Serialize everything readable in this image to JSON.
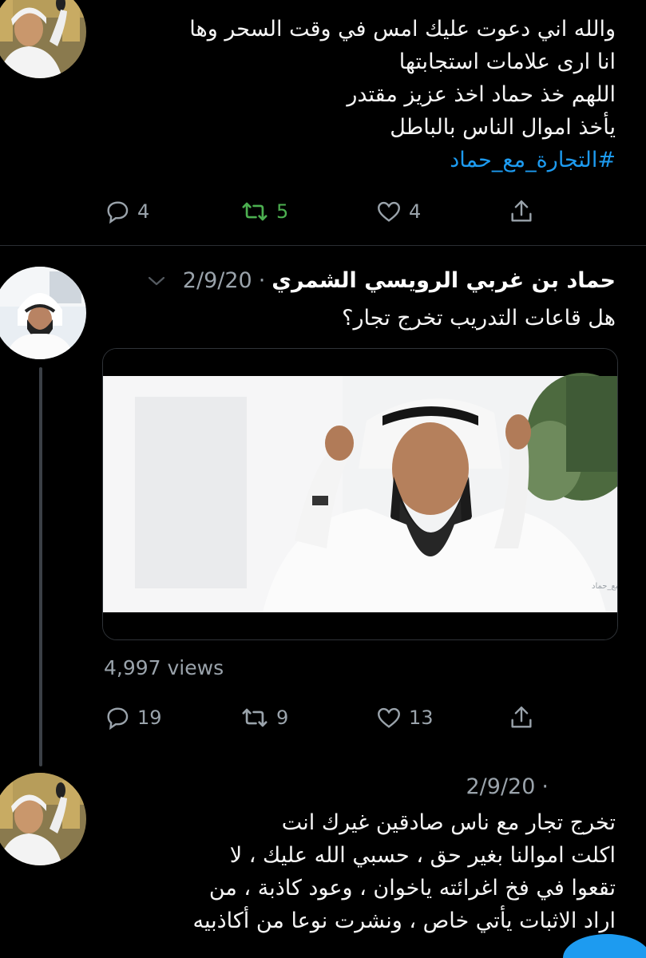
{
  "tweet1": {
    "text_lines": [
      "والله اني دعوت عليك امس في وقت السحر وها",
      "انا ارى علامات استجابتها",
      "اللهم خذ حماد اخذ عزيز مقتدر",
      "يأخذ اموال الناس بالباطل"
    ],
    "hashtag": "#التجارة_مع_حماد",
    "replies": "4",
    "retweets": "5",
    "likes": "4"
  },
  "tweet2": {
    "display_name": "حماد بن غربي الرويسي الشمري",
    "separator": "·",
    "date": "2/9/20",
    "text": "هل قاعات التدريب تخرج تجار؟",
    "video_watermark": "#التجارة_مع_حماد",
    "views": "4,997 views",
    "replies": "19",
    "retweets": "9",
    "likes": "13"
  },
  "tweet3": {
    "separator": "·",
    "date": "2/9/20",
    "text_lines": [
      "تخرج تجار مع ناس صادقين غيرك انت",
      "اكلت اموالنا بغير حق ، حسبي الله عليك ، لا",
      "تقعوا في فخ اغرائته ياخوان ، وعود كاذبة ، من",
      "اراد الاثبات يأتي خاص ، ونشرت نوعا من أكاذبيه"
    ]
  },
  "colors": {
    "background": "#000000",
    "text": "#f5f5f5",
    "muted": "#9aa3ab",
    "hashtag": "#1d9bf0",
    "retweet_active": "#4caf50",
    "divider": "#2a2e33"
  },
  "icons": {
    "reply": "reply-icon",
    "retweet": "retweet-icon",
    "like": "heart-icon",
    "share": "share-icon",
    "more": "chevron-down-icon"
  }
}
